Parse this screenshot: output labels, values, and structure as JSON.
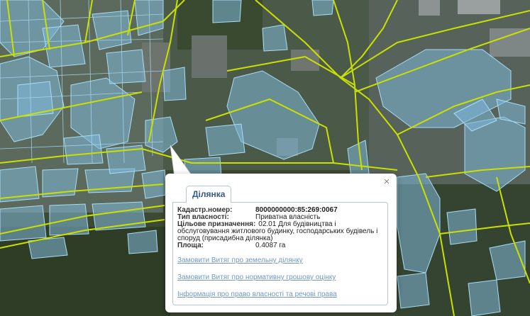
{
  "colors": {
    "parcel_fill": "#7fb8d8",
    "parcel_stroke": "#9fd4ef",
    "road": "#c9e000",
    "link": "#7097c8",
    "tab_text": "#355a86"
  },
  "popup": {
    "close_glyph": "×",
    "tab_label": "Ділянка",
    "fields": {
      "cadastral_label": "Кадастр.номер:",
      "cadastral_value": "8000000000:85:269:0067",
      "ownership_label": "Тип власності:",
      "ownership_value": "Приватна власність",
      "purpose_label": "Цільове призначення:",
      "purpose_value": "02.01 Для будівництва і обслуговування житлового будинку, господарських будівель і споруд (присадибна ділянка)",
      "area_label": "Площа:",
      "area_value": "0.4087 га"
    },
    "links": [
      "Замовити Витяг про земельну ділянку",
      "Замовити Витяг про нормативну грошову оцінку",
      "Інформація про право власності та речові права"
    ]
  }
}
